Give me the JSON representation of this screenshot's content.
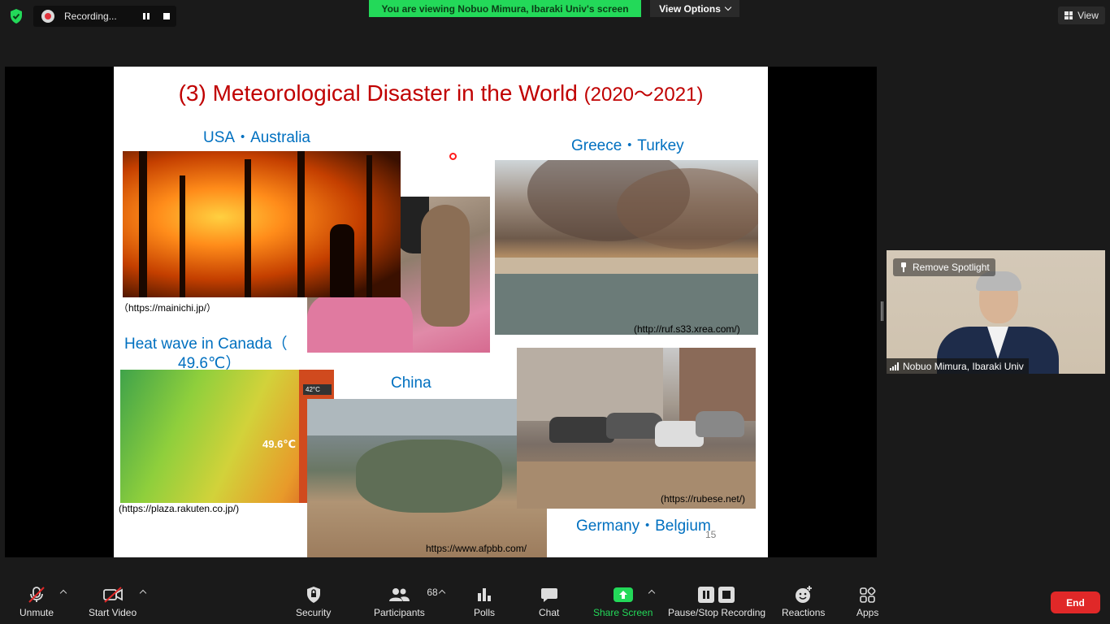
{
  "top_bar": {
    "recording_label": "Recording...",
    "viewing_banner": "You are viewing Nobuo Mimura, Ibaraki Univ's screen",
    "view_options_label": "View Options",
    "view_label": "View"
  },
  "slide": {
    "title_main": "(3) Meteorological Disaster in the World",
    "title_years": "(2020～2021)",
    "label_usa": "USA・Australia",
    "label_greece": "Greece・Turkey",
    "label_canada_1": "Heat wave in Canada（",
    "label_canada_2": "49.6℃）",
    "label_china": "China",
    "label_germany": "Germany・Belgium",
    "src_mainichi": "（https://mainichi.jp/）",
    "src_xrea": "(http://ruf.s33.xrea.com/)",
    "src_rakuten": "(https://plaza.rakuten.co.jp/)",
    "src_rubese": "(https://rubese.net/)",
    "src_afpbb": "https://www.afpbb.com/",
    "canada_temp": "49.6℃",
    "canada_badge": "42°C",
    "page_number": "15"
  },
  "spotlight": {
    "remove_label": "Remove Spotlight",
    "participant_name": "Nobuo Mimura, Ibaraki Univ"
  },
  "toolbar": {
    "unmute": "Unmute",
    "start_video": "Start Video",
    "security": "Security",
    "participants": "Participants",
    "participants_count": "68",
    "polls": "Polls",
    "chat": "Chat",
    "share_screen": "Share Screen",
    "pause_stop": "Pause/Stop Recording",
    "reactions": "Reactions",
    "apps": "Apps",
    "end": "End"
  },
  "colors": {
    "accent_green": "#23d959",
    "end_red": "#e02828",
    "slide_title_red": "#c00000",
    "slide_label_blue": "#0070c0"
  }
}
